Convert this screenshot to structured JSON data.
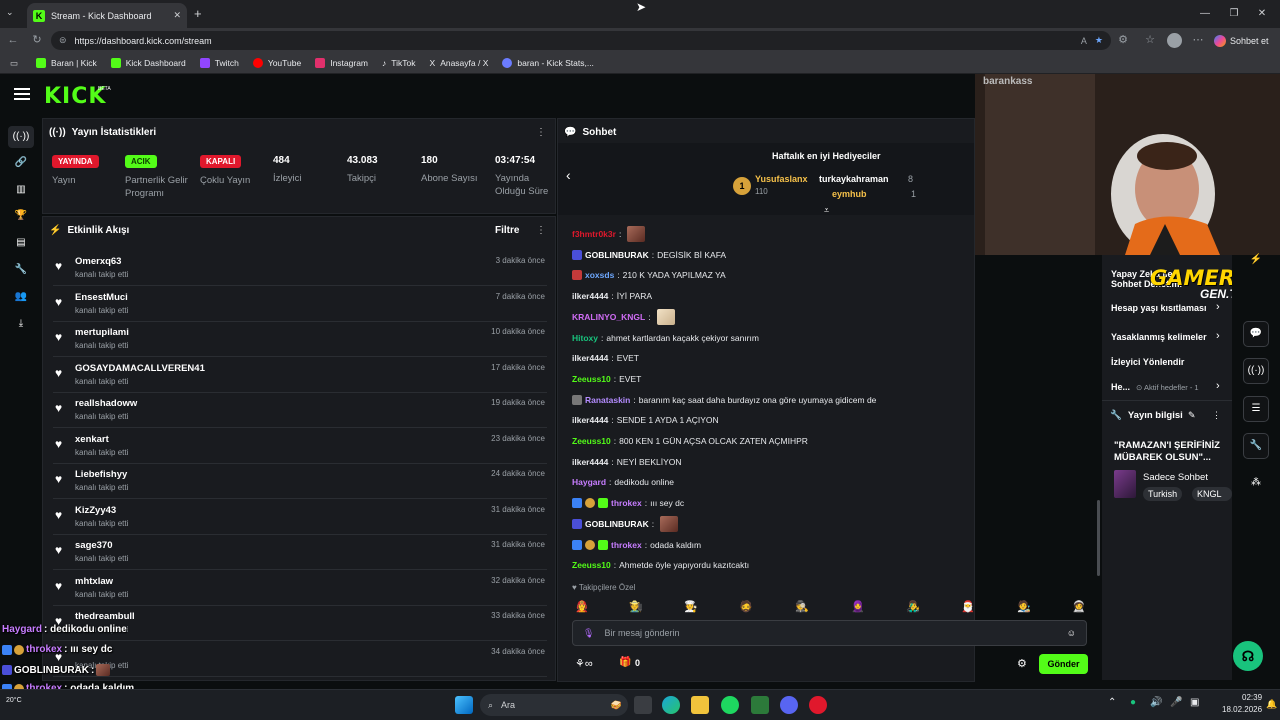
{
  "browser": {
    "tab_title": "Stream - Kick Dashboard",
    "url": "https://dashboard.kick.com/stream",
    "copilot_label": "Sohbet et",
    "bookmarks": [
      {
        "label": "Baran | Kick",
        "color": "#53fc18"
      },
      {
        "label": "Kick Dashboard",
        "color": "#53fc18"
      },
      {
        "label": "Twitch",
        "color": "#9146ff"
      },
      {
        "label": "YouTube",
        "color": "#ff0000"
      },
      {
        "label": "Instagram",
        "color": "#e1306c"
      },
      {
        "label": "TikTok",
        "color": "#ffffff"
      },
      {
        "label": "Anasayfa / X",
        "color": "#ffffff"
      },
      {
        "label": "baran - Kick Stats,...",
        "color": "#6b7cff"
      }
    ]
  },
  "header": {
    "logo": "KICK",
    "logo_badge": "BETA"
  },
  "stats": {
    "title": "Yayın İstatistikleri",
    "items": [
      {
        "badge": "YAYINDA",
        "badge_color": "#e0182c",
        "label": "Yayın"
      },
      {
        "badge": "ACIK",
        "badge_color": "#53fc18",
        "label": "Partnerlik Gelir Programı"
      },
      {
        "badge": "KAPALI",
        "badge_color": "#e0182c",
        "label": "Çoklu Yayın"
      },
      {
        "value": "484",
        "label": "İzleyici"
      },
      {
        "value": "43.083",
        "label": "Takipçi"
      },
      {
        "value": "180",
        "label": "Abone Sayısı"
      },
      {
        "value": "03:47:54",
        "label": "Yayında Olduğu Süre"
      }
    ]
  },
  "feed": {
    "title": "Etkinlik Akışı",
    "filter_label": "Filtre",
    "items": [
      {
        "name": "Omerxq63",
        "sub": "kanalı takip etti",
        "time": "3 dakika önce"
      },
      {
        "name": "EnsestMuci",
        "sub": "kanalı takip etti",
        "time": "7 dakika önce"
      },
      {
        "name": "mertupilami",
        "sub": "kanalı takip etti",
        "time": "10 dakika önce"
      },
      {
        "name": "GOSAYDAMACALLVEREN41",
        "sub": "kanalı takip etti",
        "time": "17 dakika önce"
      },
      {
        "name": "reallshadoww",
        "sub": "kanalı takip etti",
        "time": "19 dakika önce"
      },
      {
        "name": "xenkart",
        "sub": "kanalı takip etti",
        "time": "23 dakika önce"
      },
      {
        "name": "Liebefishyy",
        "sub": "kanalı takip etti",
        "time": "24 dakika önce"
      },
      {
        "name": "KizZyy43",
        "sub": "kanalı takip etti",
        "time": "31 dakika önce"
      },
      {
        "name": "sage370",
        "sub": "kanalı takip etti",
        "time": "31 dakika önce"
      },
      {
        "name": "mhtxlaw",
        "sub": "kanalı takip etti",
        "time": "32 dakika önce"
      },
      {
        "name": "thedreambull",
        "sub": "kanalı takip etti",
        "time": "33 dakika önce"
      },
      {
        "name": "",
        "sub": "kanalı takip etti",
        "time": "34 dakika önce"
      }
    ]
  },
  "chat": {
    "title": "Sohbet",
    "gifters_title": "Haftalık en iyi Hediyeciler",
    "gifters": [
      {
        "rank": "1",
        "name": "Yusufaslanx",
        "count": "110"
      },
      {
        "name": "turkaykahraman",
        "count": "8"
      },
      {
        "name": "eymhub",
        "count": "1"
      }
    ],
    "messages": [
      {
        "user": "f3hmtr0k3r",
        "color": "#e0182c",
        "text": ""
      },
      {
        "user": "GOBLINBURAK",
        "color": "#ffffff",
        "text": "DEGİSİK Bİ KAFA"
      },
      {
        "user": "xoxsds",
        "color": "#6ea8fe",
        "text": "210 K YADA YAPILMAZ YA"
      },
      {
        "user": "ilker4444",
        "color": "#e8eaed",
        "text": "İYİ PARA"
      },
      {
        "user": "KRALINYO_KNGL",
        "color": "#d06cf5",
        "text": ""
      },
      {
        "user": "Hitoxy",
        "color": "#19c37d",
        "text": "ahmet kartlardan kaçakk çekiyor sanırım"
      },
      {
        "user": "ilker4444",
        "color": "#e8eaed",
        "text": "EVET"
      },
      {
        "user": "Zeeuss10",
        "color": "#53fc18",
        "text": "EVET"
      },
      {
        "user": "Ranataskin",
        "color": "#b48cff",
        "text": "baranım kaç saat daha burdayız ona göre uyumaya gidicem de"
      },
      {
        "user": "ilker4444",
        "color": "#e8eaed",
        "text": "SENDE 1 AYDA 1 AÇIYON"
      },
      {
        "user": "Zeeuss10",
        "color": "#53fc18",
        "text": "800 KEN 1 GÜN AÇSA OLCAK ZATEN AÇMIHPR"
      },
      {
        "user": "ilker4444",
        "color": "#e8eaed",
        "text": "NEYİ BEKLİYON"
      },
      {
        "user": "Haygard",
        "color": "#c77dff",
        "text": "dedikodu online"
      },
      {
        "user": "throkex",
        "color": "#c77dff",
        "text": "ııı sey dc"
      },
      {
        "user": "GOBLINBURAK",
        "color": "#ffffff",
        "text": ""
      },
      {
        "user": "throkex",
        "color": "#c77dff",
        "text": "odada kaldım"
      },
      {
        "user": "Zeeuss10",
        "color": "#53fc18",
        "text": "Ahmetde öyle yapıyordu kazıtcaktı"
      }
    ],
    "followers_only": "Takipçilere Özel",
    "input_placeholder": "Bir mesaj gönderin",
    "points": "0",
    "send_label": "Gönder"
  },
  "right_panel": {
    "items": [
      "Yapay Zeka ile Sohbet Denetimi",
      "Hesap yaşı kısıtlaması",
      "Yasaklanmış kelimeler",
      "İzleyici Yönlendir",
      "He...",
      "Aktif hedefler - 1"
    ],
    "info_title": "Yayın bilgisi",
    "stream_title": "\"RAMAZAN'I ŞERİFİNİZ MÜBAREK OLSUN\"...",
    "category": "Sadece Sohbet",
    "tags": [
      "Turkish",
      "KNGL"
    ]
  },
  "webcam": {
    "overlay_name": "barankass",
    "brand": "GAMER",
    "brand_sub": "GEN.TR"
  },
  "overlay_chat": [
    {
      "user": "Haygard",
      "color": "#c77dff",
      "text": ": dedikodu online"
    },
    {
      "user": "throkex",
      "color": "#c77dff",
      "text": ": ııı sey dc"
    },
    {
      "user": "GOBLINBURAK",
      "color": "#ffffff",
      "text": ":"
    },
    {
      "user": "throkex",
      "color": "#c77dff",
      "text": ": odada kaldım"
    },
    {
      "user": "Zeeuss10",
      "color": "#53fc18",
      "text": ": Ahmetde öyle yapıyordu kazıtcaktı"
    }
  ],
  "taskbar": {
    "search_label": "Ara",
    "time": "02:39",
    "date": "18.02.2026",
    "weather": "20°C"
  }
}
